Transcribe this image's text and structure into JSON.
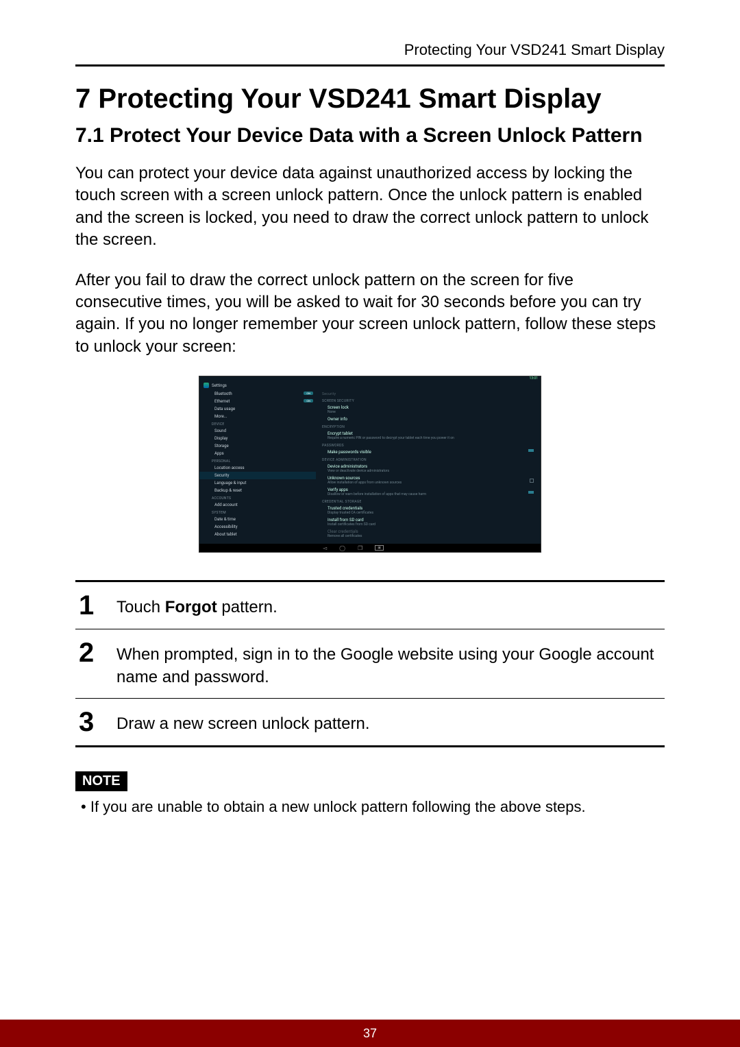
{
  "running_head": "Protecting Your VSD241 Smart Display",
  "chapter_title": "7 Protecting Your VSD241 Smart Display",
  "section_title": "7.1  Protect Your Device Data with a Screen Unlock Pattern",
  "para1": "You can protect your device data against unauthorized access by locking the touch screen with a screen unlock pattern. Once the unlock pattern is enabled and the screen is locked, you need to draw the correct unlock pattern to unlock the screen.",
  "para2": "After you fail to draw the correct unlock pattern on the screen for five consecutive times, you will be asked to wait for 30 seconds before you can try again. If you no longer remember your screen unlock pattern, follow these steps to unlock your screen:",
  "steps": [
    {
      "num": "1",
      "pre": "Touch ",
      "bold": "Forgot",
      "post": " pattern."
    },
    {
      "num": "2",
      "text": "When prompted, sign in to the Google website using your Google account name and password."
    },
    {
      "num": "3",
      "text": "Draw a new screen unlock pattern."
    }
  ],
  "note_label": "NOTE",
  "note_text": "If you are unable to obtain a new unlock pattern following the above steps.",
  "page_number": "37",
  "screenshot": {
    "status": "13:01",
    "app_title": "Settings",
    "on_label": "ON",
    "left": {
      "bluetooth": "Bluetooth",
      "ethernet": "Ethernet",
      "data_usage": "Data usage",
      "more": "More...",
      "cat_device": "DEVICE",
      "sound": "Sound",
      "display": "Display",
      "storage": "Storage",
      "apps": "Apps",
      "cat_personal": "PERSONAL",
      "location": "Location access",
      "security": "Security",
      "language": "Language & input",
      "backup": "Backup & reset",
      "cat_accounts": "ACCOUNTS",
      "add_account": "Add account",
      "cat_system": "SYSTEM",
      "datetime": "Date & time",
      "accessibility": "Accessibility",
      "about": "About tablet"
    },
    "right": {
      "title": "Security",
      "sec_screen": "SCREEN SECURITY",
      "screen_lock": "Screen lock",
      "screen_lock_sub": "None",
      "owner_info": "Owner info",
      "sec_enc": "ENCRYPTION",
      "encrypt": "Encrypt tablet",
      "encrypt_sub": "Require a numeric PIN or password to decrypt your tablet each time you power it on",
      "sec_pw": "PASSWORDS",
      "make_pw": "Make passwords visible",
      "sec_admin": "DEVICE ADMINISTRATION",
      "dev_admin": "Device administrators",
      "dev_admin_sub": "View or deactivate device administrators",
      "unknown": "Unknown sources",
      "unknown_sub": "Allow installation of apps from unknown sources",
      "verify": "Verify apps",
      "verify_sub": "Disallow or warn before installation of apps that may cause harm",
      "sec_cred": "CREDENTIAL STORAGE",
      "trusted": "Trusted credentials",
      "trusted_sub": "Display trusted CA certificates",
      "install_sd": "Install from SD card",
      "install_sd_sub": "Install certificates from SD card",
      "clear": "Clear credentials",
      "clear_sub": "Remove all certificates"
    }
  }
}
